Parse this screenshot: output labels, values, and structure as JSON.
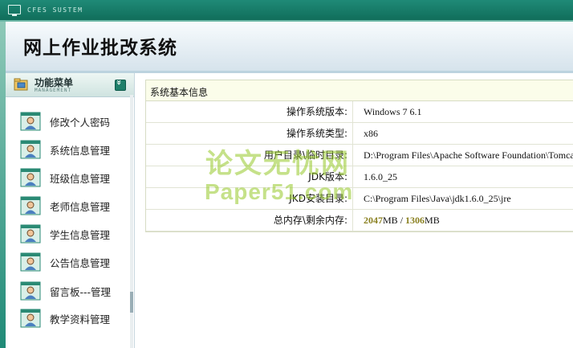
{
  "topbar": {
    "system_label": "CFES SUSTEM"
  },
  "header": {
    "title": "网上作业批改系统"
  },
  "menu": {
    "title": "功能菜单",
    "subtitle": "MANAGEMENT",
    "items": [
      {
        "label": "修改个人密码"
      },
      {
        "label": "系统信息管理"
      },
      {
        "label": "班级信息管理"
      },
      {
        "label": "老师信息管理"
      },
      {
        "label": "学生信息管理"
      },
      {
        "label": "公告信息管理"
      },
      {
        "label": "留言板---管理"
      },
      {
        "label": "教学资料管理"
      }
    ]
  },
  "info": {
    "caption": "系统基本信息",
    "rows": [
      {
        "key": "操作系统版本:",
        "value": "Windows 7  6.1"
      },
      {
        "key": "操作系统类型:",
        "value": "x86"
      },
      {
        "key": "用户目录\\临时目录:",
        "value": "D:\\Program Files\\Apache Software Foundation\\Tomcat"
      },
      {
        "key": "JDK版本:",
        "value": "1.6.0_25"
      },
      {
        "key": "JKD安装目录:",
        "value": "C:\\Program Files\\Java\\jdk1.6.0_25\\jre"
      },
      {
        "key": "总内存\\剩余内存:",
        "value_total": "2047",
        "unit1": "MB",
        "sep": " / ",
        "value_free": "1306",
        "unit2": "MB"
      }
    ]
  },
  "watermark": {
    "line1": "论文无忧网",
    "line2": "Paper51.com"
  }
}
